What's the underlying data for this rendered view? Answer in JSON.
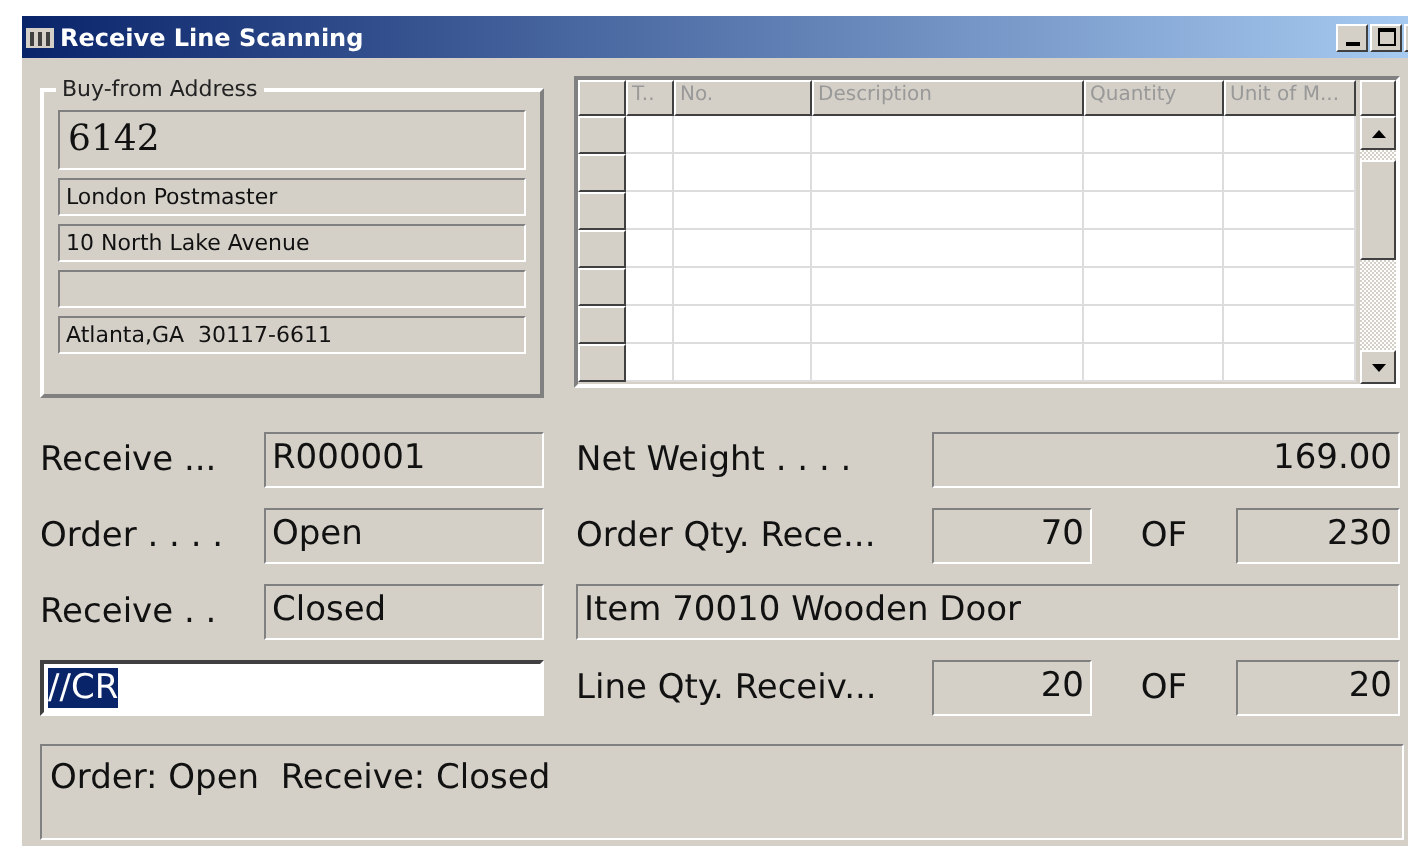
{
  "window": {
    "title": "Receive Line Scanning"
  },
  "address": {
    "legend": "Buy-from Address",
    "lines": [
      {
        "kind": "text",
        "text": "6142"
      },
      {
        "kind": "text",
        "text": "London Postmaster"
      },
      {
        "kind": "text",
        "text": "10 North Lake Avenue"
      },
      {
        "kind": "blank"
      },
      {
        "kind": "text",
        "text": "Atlanta,GA  30117-6611"
      }
    ]
  },
  "grid": {
    "columns": [
      "T..",
      "No.",
      "Description",
      "Quantity",
      "Unit of M..."
    ]
  },
  "left_fields": [
    {
      "label": "Receive ...",
      "value": "R000001"
    },
    {
      "label": "Order . . . .",
      "value": "Open"
    },
    {
      "label": "Receive . .",
      "value": "Closed"
    }
  ],
  "scan_field": {
    "value": "//CR",
    "selected": true
  },
  "net_weight": {
    "label": "Net Weight . . . .",
    "value": "169.00"
  },
  "order_qty": {
    "label": "Order Qty. Rece...",
    "value": "70",
    "of": "OF",
    "total": "230"
  },
  "item_line": {
    "value": "Item 70010 Wooden Door"
  },
  "line_qty": {
    "label": "Line Qty. Receiv...",
    "value": "20",
    "of": "OF",
    "total": "20"
  },
  "status": {
    "text": "Order: Open  Receive: Closed"
  }
}
